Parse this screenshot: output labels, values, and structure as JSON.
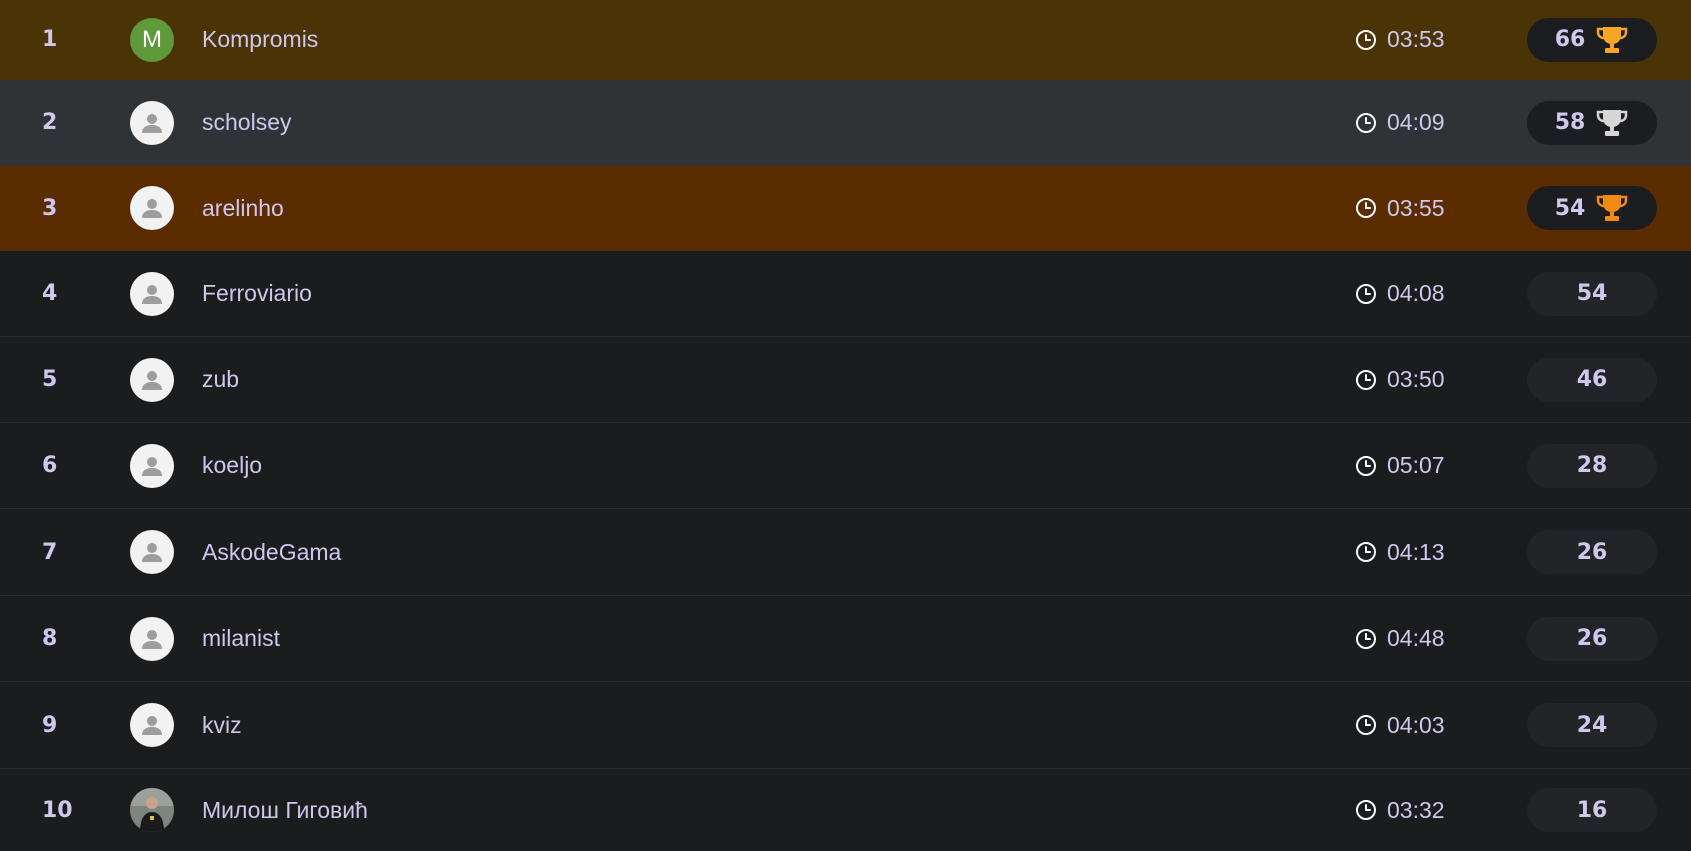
{
  "colors": {
    "gold_row": "#4a3305",
    "silver_row": "#2f3336",
    "bronze_row": "#5a2c00",
    "gold_trophy": "#f5a623",
    "silver_trophy": "#d6d6d6",
    "bronze_trophy": "#f08a12",
    "text": "#cfc7ec"
  },
  "leaderboard": [
    {
      "rank": "1",
      "name": "Kompromis",
      "time": "03:53",
      "score": "66",
      "avatar": "letter",
      "avatar_letter": "M",
      "medal": "gold"
    },
    {
      "rank": "2",
      "name": "scholsey",
      "time": "04:09",
      "score": "58",
      "avatar": "default",
      "medal": "silver"
    },
    {
      "rank": "3",
      "name": "arelinho",
      "time": "03:55",
      "score": "54",
      "avatar": "default",
      "medal": "bronze"
    },
    {
      "rank": "4",
      "name": "Ferroviario",
      "time": "04:08",
      "score": "54",
      "avatar": "default",
      "medal": ""
    },
    {
      "rank": "5",
      "name": "zub",
      "time": "03:50",
      "score": "46",
      "avatar": "default",
      "medal": ""
    },
    {
      "rank": "6",
      "name": "koeljo",
      "time": "05:07",
      "score": "28",
      "avatar": "default",
      "medal": ""
    },
    {
      "rank": "7",
      "name": "AskodeGama",
      "time": "04:13",
      "score": "26",
      "avatar": "default",
      "medal": ""
    },
    {
      "rank": "8",
      "name": "milanist",
      "time": "04:48",
      "score": "26",
      "avatar": "default",
      "medal": ""
    },
    {
      "rank": "9",
      "name": "kviz",
      "time": "04:03",
      "score": "24",
      "avatar": "default",
      "medal": ""
    },
    {
      "rank": "10",
      "name": "Милош Гиговић",
      "time": "03:32",
      "score": "16",
      "avatar": "photo",
      "medal": ""
    }
  ]
}
